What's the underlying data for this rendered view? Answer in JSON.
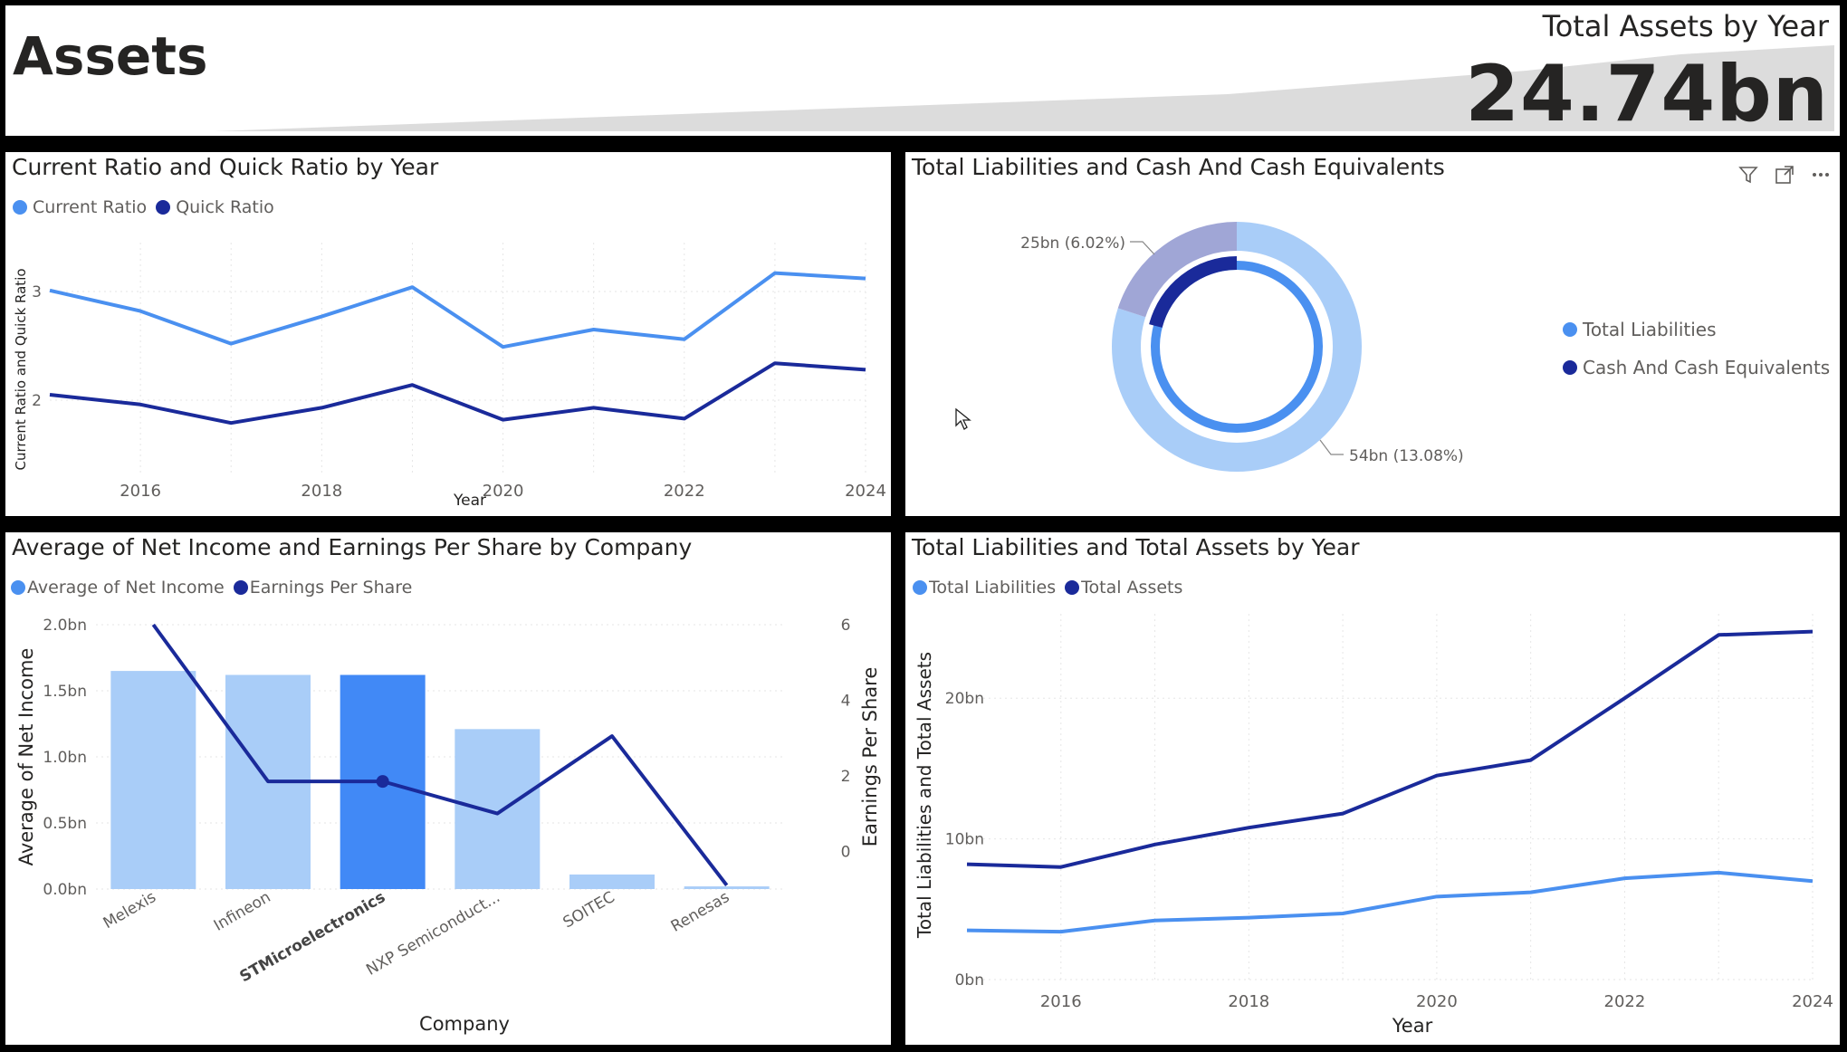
{
  "header": {
    "title": "Assets",
    "kpi_label": "Total Assets by Year",
    "kpi_value": "24.74bn"
  },
  "colors": {
    "light": "#4a90f0",
    "dark": "#1a2a9a",
    "bar_light": "#a9cdf8",
    "bar_selected": "#4189f6"
  },
  "panel1": {
    "title": "Current Ratio and Quick Ratio by Year",
    "legend": [
      "Current Ratio",
      "Quick Ratio"
    ]
  },
  "panel2": {
    "title": "Total Liabilities and Cash And Cash Equivalents",
    "legend": [
      "Total Liabilities",
      "Cash And Cash Equivalents"
    ],
    "icons": [
      "filter-icon",
      "focus-mode-icon",
      "more-options-icon"
    ]
  },
  "panel3": {
    "title": "Average of Net Income and Earnings Per Share by Company",
    "legend": [
      "Average of Net Income",
      "Earnings Per Share"
    ]
  },
  "panel4": {
    "title": "Total Liabilities and Total Assets by Year",
    "legend": [
      "Total Liabilities",
      "Total Assets"
    ]
  },
  "chart_data": [
    {
      "type": "line",
      "title": "Current Ratio and Quick Ratio by Year",
      "xlabel": "Year",
      "ylabel": "Current Ratio and Quick Ratio",
      "x": [
        2015,
        2016,
        2017,
        2018,
        2019,
        2020,
        2021,
        2022,
        2023,
        2024
      ],
      "x_ticks": [
        "2016",
        "2018",
        "2020",
        "2022",
        "2024"
      ],
      "y_ticks": [
        "2",
        "3"
      ],
      "ylim": [
        1.3,
        3.45
      ],
      "series": [
        {
          "name": "Current Ratio",
          "values": [
            3.01,
            2.82,
            2.52,
            2.77,
            3.04,
            2.49,
            2.65,
            2.56,
            3.17,
            3.12
          ]
        },
        {
          "name": "Quick Ratio",
          "values": [
            2.05,
            1.96,
            1.79,
            1.93,
            2.14,
            1.82,
            1.93,
            1.83,
            2.34,
            2.28
          ]
        }
      ]
    },
    {
      "type": "pie",
      "title": "Total Liabilities and Cash And Cash Equivalents",
      "data_labels": [
        "25bn (6.02%)",
        "54bn (13.08%)"
      ],
      "rings": [
        {
          "name": "Total Liabilities",
          "fraction": 1.0
        },
        {
          "name": "Cash And Cash Equivalents",
          "fraction": 0.1
        }
      ],
      "outer_split": 0.8
    },
    {
      "type": "bar",
      "title": "Average of Net Income and Earnings Per Share by Company",
      "xlabel": "Company",
      "ylabel": "Average of Net Income",
      "y2label": "Earnings Per Share",
      "categories": [
        "Melexis",
        "Infineon",
        "STMicroelectronics",
        "NXP Semiconduct...",
        "SOITEC",
        "Renesas"
      ],
      "selected_category": "STMicroelectronics",
      "y_ticks": [
        "0.0bn",
        "0.5bn",
        "1.0bn",
        "1.5bn",
        "2.0bn"
      ],
      "y2_ticks": [
        "0",
        "2",
        "4",
        "6"
      ],
      "ylim": [
        0,
        2.0
      ],
      "y2lim": [
        -1,
        6
      ],
      "series": [
        {
          "name": "Average of Net Income",
          "kind": "bar",
          "values": [
            1.65,
            1.62,
            1.62,
            1.21,
            0.11,
            0.02
          ]
        },
        {
          "name": "Earnings Per Share",
          "kind": "line",
          "values": [
            6.0,
            1.85,
            1.85,
            1.0,
            3.05,
            -0.9
          ]
        }
      ]
    },
    {
      "type": "line",
      "title": "Total Liabilities and Total Assets by Year",
      "xlabel": "Year",
      "ylabel": "Total Liabilities and Total Assets",
      "x": [
        2015,
        2016,
        2017,
        2018,
        2019,
        2020,
        2021,
        2022,
        2023,
        2024
      ],
      "x_ticks": [
        "2016",
        "2018",
        "2020",
        "2022",
        "2024"
      ],
      "y_ticks": [
        "0bn",
        "10bn",
        "20bn"
      ],
      "ylim": [
        0,
        26
      ],
      "series": [
        {
          "name": "Total Liabilities",
          "values": [
            3.5,
            3.4,
            4.2,
            4.4,
            4.7,
            5.9,
            6.2,
            7.2,
            7.6,
            7.0
          ]
        },
        {
          "name": "Total Assets",
          "values": [
            8.2,
            8.0,
            9.6,
            10.8,
            11.8,
            14.5,
            15.6,
            20.0,
            24.5,
            24.74
          ]
        }
      ]
    }
  ]
}
